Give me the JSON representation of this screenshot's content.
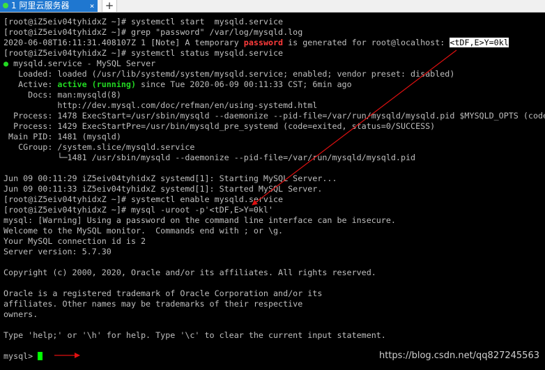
{
  "tab": {
    "label": "1 阿里云服务器",
    "close_glyph": "×",
    "add_glyph": "+"
  },
  "terminal": {
    "prompt": "[root@iZ5eiv04tyhidxZ ~]#",
    "lines": {
      "l1": "[root@iZ5eiv04tyhidxZ ~]# systemctl start  mysqld.service",
      "l2": "[root@iZ5eiv04tyhidxZ ~]# grep \"password\" /var/log/mysqld.log",
      "l3_pre": "2020-06-08T16:11:31.408107Z 1 [Note] A temporary ",
      "l3_kw": "password",
      "l3_mid": " is generated for root@localhost: ",
      "l3_pw": "<tDF,E>Y=0kl",
      "l4": "[root@iZ5eiv04tyhidxZ ~]# systemctl status mysqld.service",
      "l5_dot": "●",
      "l5": " mysqld.service - MySQL Server",
      "l6": "   Loaded: loaded (/usr/lib/systemd/system/mysqld.service; enabled; vendor preset: disabled)",
      "l7_pre": "   Active: ",
      "l7_kw": "active (running)",
      "l7_post": " since Tue 2020-06-09 00:11:33 CST; 6min ago",
      "l8": "     Docs: man:mysqld(8)",
      "l9": "           http://dev.mysql.com/doc/refman/en/using-systemd.html",
      "l10": "  Process: 1478 ExecStart=/usr/sbin/mysqld --daemonize --pid-file=/var/run/mysqld/mysqld.pid $MYSQLD_OPTS (code",
      "l11": "  Process: 1429 ExecStartPre=/usr/bin/mysqld_pre_systemd (code=exited, status=0/SUCCESS)",
      "l12": " Main PID: 1481 (mysqld)",
      "l13": "   CGroup: /system.slice/mysqld.service",
      "l14": "           └─1481 /usr/sbin/mysqld --daemonize --pid-file=/var/run/mysqld/mysqld.pid",
      "l15": "",
      "l16": "Jun 09 00:11:29 iZ5eiv04tyhidxZ systemd[1]: Starting MySQL Server...",
      "l17": "Jun 09 00:11:33 iZ5eiv04tyhidxZ systemd[1]: Started MySQL Server.",
      "l18": "[root@iZ5eiv04tyhidxZ ~]# systemctl enable mysqld.service",
      "l19": "[root@iZ5eiv04tyhidxZ ~]# mysql -uroot -p'<tDF,E>Y=0kl'",
      "l20": "mysql: [Warning] Using a password on the command line interface can be insecure.",
      "l21": "Welcome to the MySQL monitor.  Commands end with ; or \\g.",
      "l22": "Your MySQL connection id is 2",
      "l23": "Server version: 5.7.30",
      "l24": "",
      "l25": "Copyright (c) 2000, 2020, Oracle and/or its affiliates. All rights reserved.",
      "l26": "",
      "l27": "Oracle is a registered trademark of Oracle Corporation and/or its",
      "l28": "affiliates. Other names may be trademarks of their respective",
      "l29": "owners.",
      "l30": "",
      "l31": "Type 'help;' or '\\h' for help. Type '\\c' to clear the current input statement.",
      "l32": "",
      "l33": "mysql> "
    }
  },
  "colors": {
    "background": "#000000",
    "text": "#bfbfbf",
    "highlight_red": "#ff3b3b",
    "status_green": "#22d822",
    "cursor_green": "#00ff00",
    "annotation_arrow": "#e01010",
    "tab_blue": "#1f77d0"
  },
  "watermark": "https://blog.csdn.net/qq827245563"
}
